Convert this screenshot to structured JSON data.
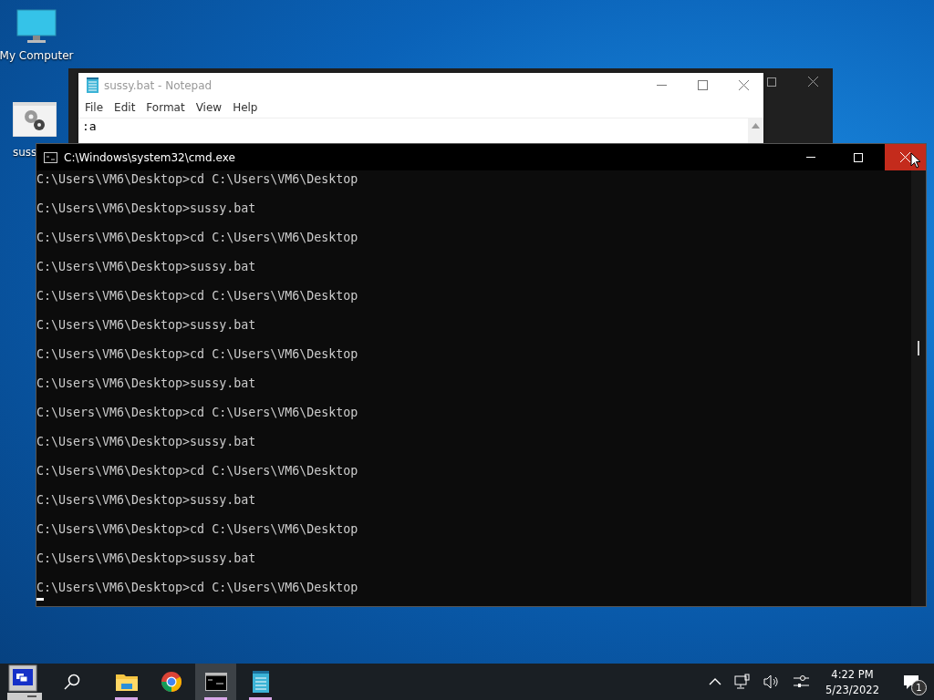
{
  "desktop_icons": [
    {
      "label": "My Computer",
      "kind": "computer"
    },
    {
      "label": "suss",
      "kind": "batch"
    }
  ],
  "notepad": {
    "title": "sussy.bat - Notepad",
    "menu": [
      "File",
      "Edit",
      "Format",
      "View",
      "Help"
    ],
    "lines": [
      ":a"
    ]
  },
  "cmd": {
    "title": "C:\\Windows\\system32\\cmd.exe",
    "close_hovered": true,
    "lines": [
      "C:\\Users\\VM6\\Desktop>cd C:\\Users\\VM6\\Desktop",
      "C:\\Users\\VM6\\Desktop>sussy.bat",
      "C:\\Users\\VM6\\Desktop>cd C:\\Users\\VM6\\Desktop",
      "C:\\Users\\VM6\\Desktop>sussy.bat",
      "C:\\Users\\VM6\\Desktop>cd C:\\Users\\VM6\\Desktop",
      "C:\\Users\\VM6\\Desktop>sussy.bat",
      "C:\\Users\\VM6\\Desktop>cd C:\\Users\\VM6\\Desktop",
      "C:\\Users\\VM6\\Desktop>sussy.bat",
      "C:\\Users\\VM6\\Desktop>cd C:\\Users\\VM6\\Desktop",
      "C:\\Users\\VM6\\Desktop>sussy.bat",
      "C:\\Users\\VM6\\Desktop>cd C:\\Users\\VM6\\Desktop",
      "C:\\Users\\VM6\\Desktop>sussy.bat",
      "C:\\Users\\VM6\\Desktop>cd C:\\Users\\VM6\\Desktop",
      "C:\\Users\\VM6\\Desktop>sussy.bat",
      "C:\\Users\\VM6\\Desktop>cd C:\\Users\\VM6\\Desktop"
    ]
  },
  "taskbar": {
    "apps": [
      {
        "kind": "explorer",
        "running": true,
        "selected": false
      },
      {
        "kind": "chrome",
        "running": false,
        "selected": false
      },
      {
        "kind": "console",
        "running": true,
        "selected": true
      },
      {
        "kind": "notepad",
        "running": true,
        "selected": false
      }
    ],
    "time": "4:22 PM",
    "date": "5/23/2022",
    "notifications": "1"
  }
}
